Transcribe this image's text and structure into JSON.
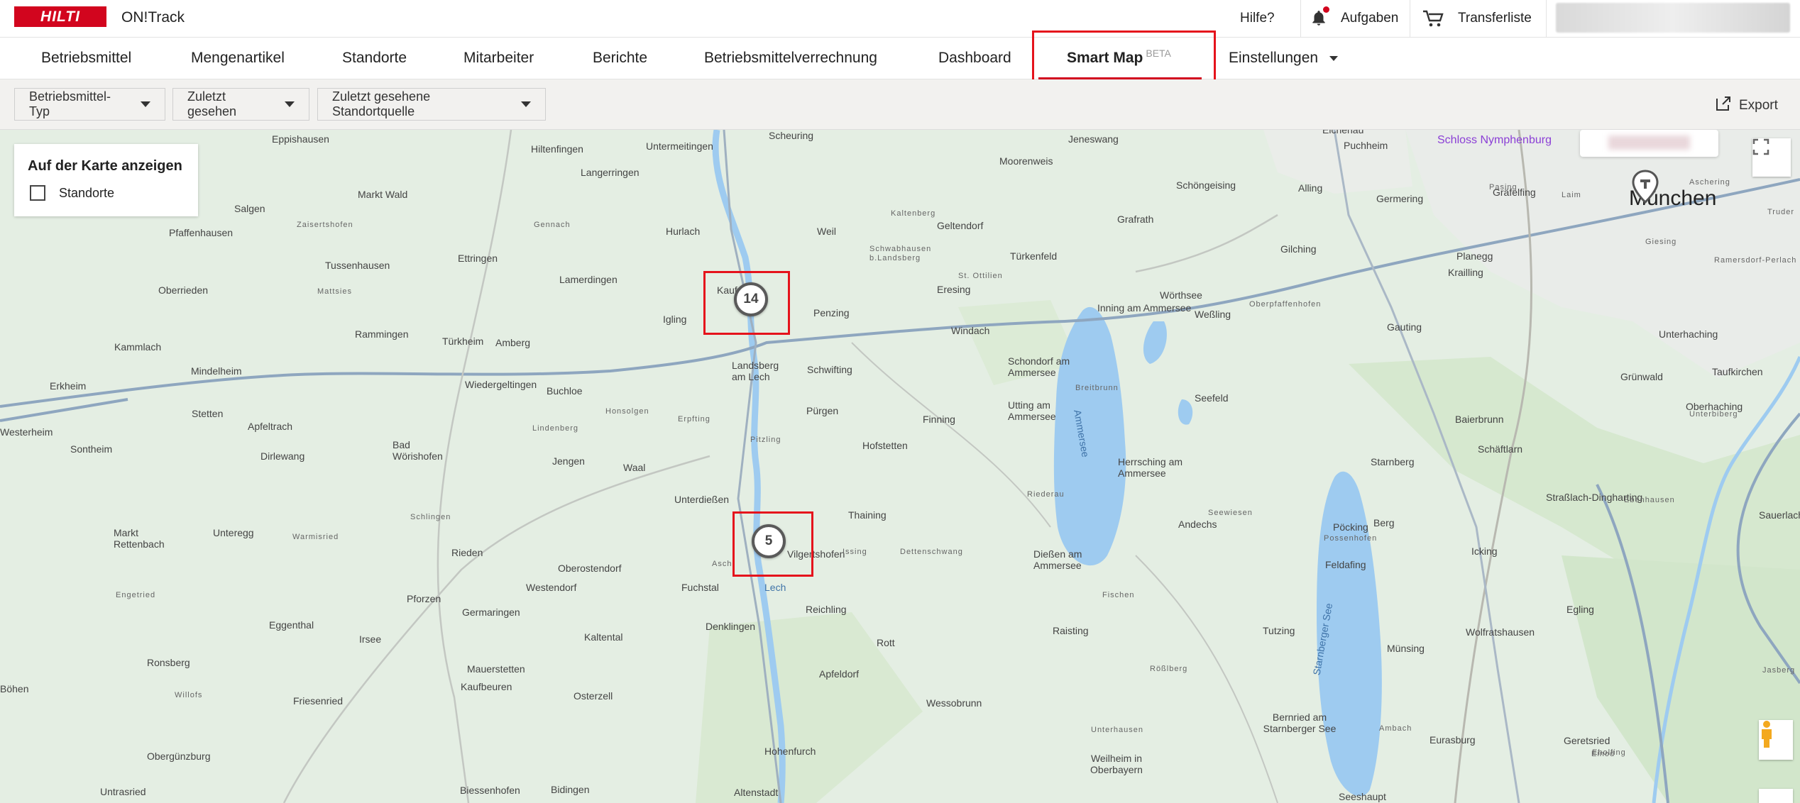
{
  "header": {
    "logo_text": "HILTI",
    "app_name": "ON!Track",
    "help_label": "Hilfe?",
    "tasks_label": "Aufgaben",
    "transfer_label": "Transferliste"
  },
  "nav": {
    "items": [
      "Betriebsmittel",
      "Mengenartikel",
      "Standorte",
      "Mitarbeiter",
      "Berichte",
      "Betriebsmittelverrechnung",
      "Dashboard"
    ],
    "smart_map": "Smart Map",
    "beta": "BETA",
    "settings": "Einstellungen"
  },
  "filters": {
    "type": "Betriebsmittel-Typ",
    "last_seen": "Zuletzt gesehen",
    "source": "Zuletzt gesehene Standortquelle",
    "export": "Export"
  },
  "overlay": {
    "title": "Auf der Karte anzeigen",
    "checkbox_label": "Standorte"
  },
  "clusters": {
    "north_count": "14",
    "south_count": "5"
  },
  "map_labels": {
    "munich": "München",
    "poi_schloss": "Schloss Nymphenburg",
    "lake_ammersee": "Ammersee",
    "lake_starnberg": "Starnberger See",
    "places": [
      "Eppishausen",
      "Hiltenfingen",
      "Untermeitingen",
      "Scheuring",
      "Jeneswang",
      "Puchheim",
      "Eichenau",
      "Moorenweis",
      "Schöngeising",
      "Alling",
      "Germering",
      "Pasing",
      "Laim",
      "Markt Wald",
      "Langerringen",
      "Salgen",
      "Hurlach",
      "Weil",
      "Geltendorf",
      "Grafrath",
      "Gilching",
      "Gräfelfing",
      "Pfaffenhausen",
      "Ettringen",
      "Lamerdingen",
      "Türkenfeld",
      "Planegg",
      "Krailling",
      "Tussenhausen",
      "Kaufering",
      "Penzing",
      "Eresing",
      "Wörthsee",
      "Weßling",
      "Oberrieden",
      "Igling",
      "Windach",
      "Inning am Ammersee",
      "Gauting",
      "Kammlach",
      "Rammingen",
      "Türkheim",
      "Amberg",
      "Landsberg am Lech",
      "Schwifting",
      "Unterhaching",
      "Mindelheim",
      "Schondorf am Ammersee",
      "Grünwald",
      "Taufkirchen",
      "Erkheim",
      "Wiedergeltingen",
      "Buchloe",
      "Seefeld",
      "Oberhaching",
      "Stetten",
      "Apfeltrach",
      "Pürgen",
      "Finning",
      "Utting am Ammersee",
      "Baierbrunn",
      "Westerheim",
      "Sontheim",
      "Bad Wörishofen",
      "Jengen",
      "Hofstetten",
      "Dirlewang",
      "Waal",
      "Herrsching am Ammersee",
      "Starnberg",
      "Schäftlarn",
      "Straßlach-Dingharting",
      "Unterdießen",
      "Thaining",
      "Andechs",
      "Berg",
      "Icking",
      "Sauerlach",
      "Unteregg",
      "Markt Rettenbach",
      "Rieden",
      "Oberostendorf",
      "Vilgertshofen",
      "Dießen am Ammersee",
      "Pöcking",
      "Feldafing",
      "Westendorf",
      "Fuchstal",
      "Pforzen",
      "Germaringen",
      "Denklingen",
      "Reichling",
      "Raisting",
      "Tutzing",
      "Wolfratshausen",
      "Egling",
      "Eggenthal",
      "Irsee",
      "Kaltental",
      "Rott",
      "Münsing",
      "Ronsberg",
      "Mauerstetten",
      "Kaufbeuren",
      "Osterzell",
      "Apfeldorf",
      "Böhen",
      "Friesenried",
      "Wessobrunn",
      "Bernried am Starnberger See",
      "Eurasburg",
      "Geretsried",
      "Obergünzburg",
      "Hohenfurch",
      "Weilheim in Oberbayern",
      "Untrasried",
      "Bidingen",
      "Altenstadt",
      "Seeshaupt",
      "Biessenhofen",
      "Zaisertshofen",
      "Gennach",
      "Kaltenberg",
      "Schwabhausen b.Landsberg",
      "St. Ottilien",
      "Oberpfaffenhofen",
      "Mattsies",
      "Honsolgen",
      "Erpfting",
      "Lindenberg",
      "Pitzling",
      "Breitbrunn",
      "Riederau",
      "Schlingen",
      "Warmisried",
      "Issing",
      "Dettenschwang",
      "Seewiesen",
      "Possenhofen",
      "Fischen",
      "Engetried",
      "Willofs",
      "Rößlberg",
      "Unterhausen",
      "Ambach",
      "Eholfing",
      "Ramersdorf-Perlach",
      "Giesing",
      "Ebenhausen",
      "Unterbiberg",
      "Truder",
      "Jasberg",
      "Einod",
      "Aschering",
      "Asch",
      "Lech",
      "Kaufering",
      "Hausen",
      "Vilgertshofen"
    ]
  },
  "colors": {
    "brand_red": "#d2051e",
    "highlight_red": "#e5131c",
    "map_land": "#e4eee3",
    "water": "#9ecbf0"
  }
}
